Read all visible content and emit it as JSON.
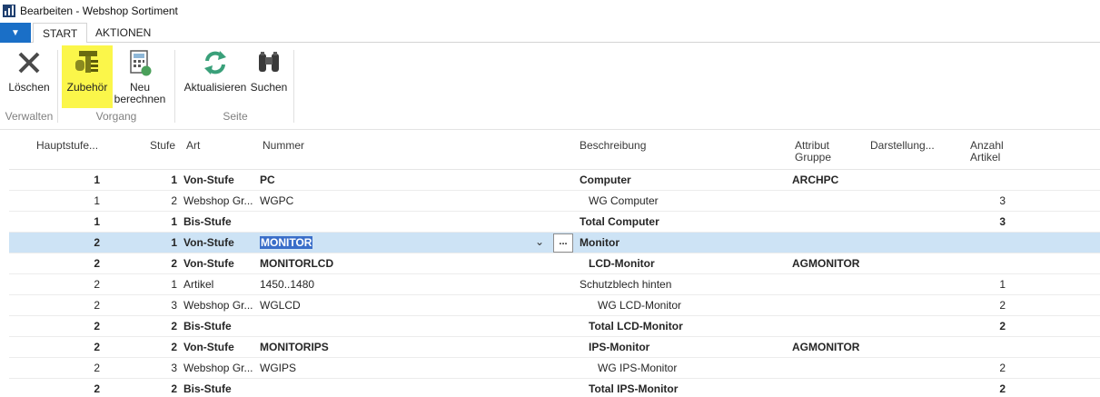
{
  "window": {
    "title": "Bearbeiten - Webshop Sortiment"
  },
  "tabs": {
    "start": "START",
    "actions": "AKTIONEN"
  },
  "ribbon": {
    "delete": "Löschen",
    "accessories": "Zubehör",
    "recalc_line1": "Neu",
    "recalc_line2": "berechnen",
    "refresh": "Aktualisieren",
    "search": "Suchen",
    "group_manage": "Verwalten",
    "group_process": "Vorgang",
    "group_page": "Seite"
  },
  "grid": {
    "headers": {
      "main_level": "Hauptstufe...",
      "level": "Stufe",
      "type": "Art",
      "number": "Nummer",
      "description": "Beschreibung",
      "attr_line1": "Attribut",
      "attr_line2": "Gruppe",
      "display": "Darstellung...",
      "count_line1": "Anzahl",
      "count_line2": "Artikel"
    },
    "rows": [
      {
        "main": "1",
        "level": "1",
        "type": "Von-Stufe",
        "number": "PC",
        "desc": "Computer",
        "attr": "ARCHPC",
        "count": ""
      },
      {
        "main": "1",
        "level": "2",
        "type": "Webshop Gr...",
        "number": "WGPC",
        "desc": "WG Computer",
        "attr": "",
        "count": "3"
      },
      {
        "main": "1",
        "level": "1",
        "type": "Bis-Stufe",
        "number": "",
        "desc": "Total Computer",
        "attr": "",
        "count": "3"
      },
      {
        "main": "2",
        "level": "1",
        "type": "Von-Stufe",
        "number": "MONITOR",
        "desc": "Monitor",
        "attr": "",
        "count": ""
      },
      {
        "main": "2",
        "level": "2",
        "type": "Von-Stufe",
        "number": "MONITORLCD",
        "desc": "LCD-Monitor",
        "attr": "AGMONITOR",
        "count": ""
      },
      {
        "main": "2",
        "level": "1",
        "type": "Artikel",
        "number": "1450..1480",
        "desc": "Schutzblech hinten",
        "attr": "",
        "count": "1"
      },
      {
        "main": "2",
        "level": "3",
        "type": "Webshop Gr...",
        "number": "WGLCD",
        "desc": "WG LCD-Monitor",
        "attr": "",
        "count": "2"
      },
      {
        "main": "2",
        "level": "2",
        "type": "Bis-Stufe",
        "number": "",
        "desc": "Total LCD-Monitor",
        "attr": "",
        "count": "2"
      },
      {
        "main": "2",
        "level": "2",
        "type": "Von-Stufe",
        "number": "MONITORIPS",
        "desc": "IPS-Monitor",
        "attr": "AGMONITOR",
        "count": ""
      },
      {
        "main": "2",
        "level": "3",
        "type": "Webshop Gr...",
        "number": "WGIPS",
        "desc": "WG IPS-Monitor",
        "attr": "",
        "count": "2"
      },
      {
        "main": "2",
        "level": "2",
        "type": "Bis-Stufe",
        "number": "",
        "desc": "Total IPS-Monitor",
        "attr": "",
        "count": "2"
      }
    ],
    "lookup_label": "..."
  }
}
